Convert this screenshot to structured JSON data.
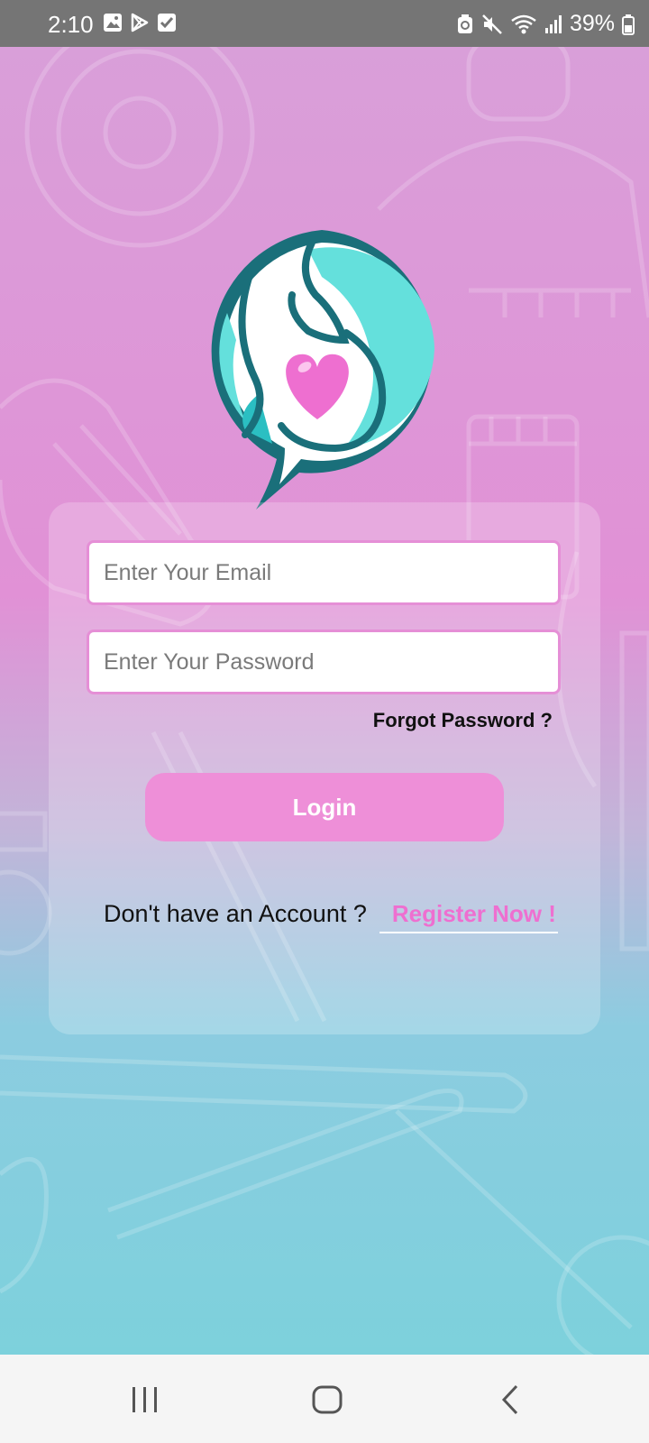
{
  "status_bar": {
    "time": "2:10",
    "battery_percent": "39%",
    "left_icons": [
      "gallery-icon",
      "play-store-icon",
      "checkbox-icon"
    ],
    "right_icons": [
      "recycle-icon",
      "mute-icon",
      "wifi-icon",
      "signal-icon",
      "battery-icon"
    ]
  },
  "logo": {
    "icon": "pregnancy-chat-heart-logo",
    "colors": {
      "teal": "#1a6f7a",
      "aqua": "#64e0dc",
      "heart": "#ee6fd0"
    }
  },
  "login_form": {
    "email_placeholder": "Enter Your Email",
    "email_value": "",
    "password_placeholder": "Enter Your Password",
    "password_value": "",
    "forgot_password": "Forgot Password ?",
    "login_button": "Login",
    "no_account_text": "Don't have an Account ?",
    "register_link": "Register Now !"
  },
  "theme": {
    "accent": "#ee8fd8",
    "link": "#ee6fd0"
  },
  "nav_bar": {
    "buttons": [
      "recents-icon",
      "home-icon",
      "back-icon"
    ]
  }
}
